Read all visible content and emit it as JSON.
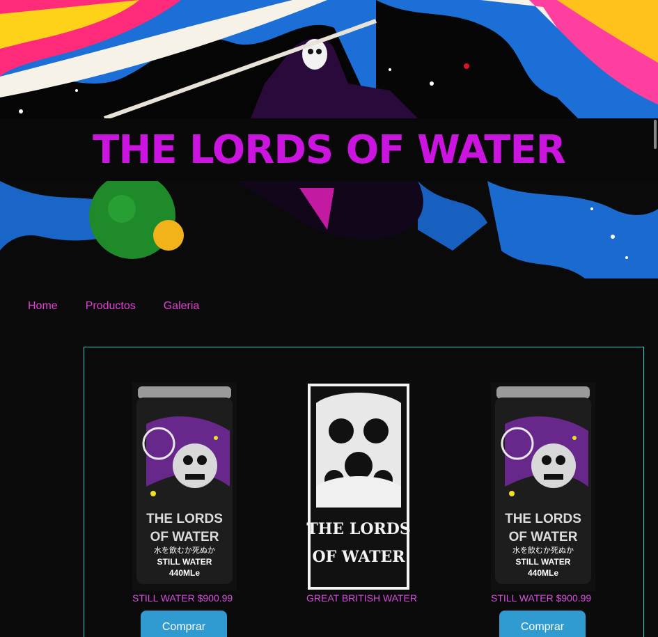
{
  "header": {
    "title": "THE LORDS OF WATER"
  },
  "nav": {
    "items": [
      {
        "label": "Home"
      },
      {
        "label": "Productos"
      },
      {
        "label": "Galeria"
      }
    ]
  },
  "products": [
    {
      "name": "STILL WATER $900.99",
      "button": "Comprar",
      "can_lines": [
        "THE LORDS",
        "OF WATER",
        "水を飲むか死ぬか",
        "STILL WATER",
        "440MLe"
      ]
    },
    {
      "name": "GREAT BRITISH WATER",
      "art_lines": [
        "THE LORDS",
        "OF WATER"
      ]
    },
    {
      "name": "STILL WATER $900.99",
      "button": "Comprar",
      "can_lines": [
        "THE LORDS",
        "OF WATER",
        "水を飲むか死ぬか",
        "STILL WATER",
        "440MLe"
      ]
    }
  ],
  "colors": {
    "title": "#cc14e0",
    "nav_link": "#e53fd8",
    "panel_border": "#3cc7c9",
    "button_bg": "#2f9bd1",
    "background": "#0b0b0b"
  }
}
